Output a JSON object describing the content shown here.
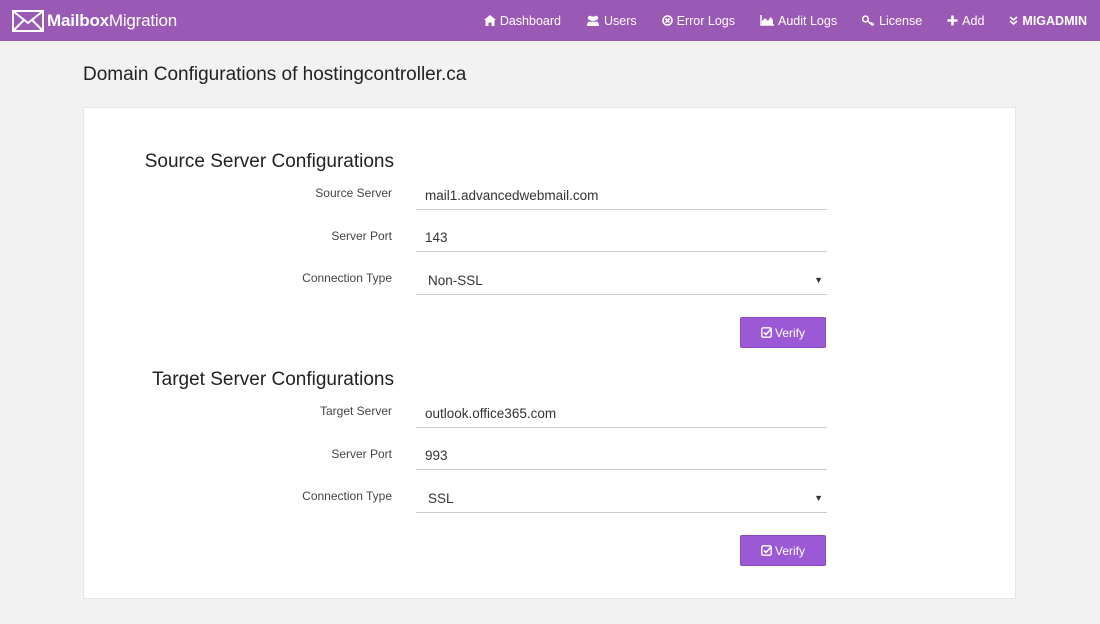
{
  "brand": {
    "part1": "Mailbox",
    "part2": "Migration"
  },
  "nav": [
    {
      "label": "Dashboard",
      "icon": "home-icon"
    },
    {
      "label": "Users",
      "icon": "users-icon"
    },
    {
      "label": "Error Logs",
      "icon": "error-circle-icon"
    },
    {
      "label": "Audit Logs",
      "icon": "area-chart-icon"
    },
    {
      "label": "License",
      "icon": "key-icon"
    },
    {
      "label": "Add",
      "icon": "plus-icon"
    },
    {
      "label": "MIGADMIN",
      "icon": "double-chevron-down-icon"
    }
  ],
  "page_title": "Domain Configurations of hostingcontroller.ca",
  "source": {
    "title": "Source Server Configurations",
    "server_label": "Source Server",
    "server_value": "mail1.advancedwebmail.com",
    "port_label": "Server Port",
    "port_value": "143",
    "conn_label": "Connection Type",
    "conn_value": "Non-SSL",
    "verify_label": "Verify"
  },
  "target": {
    "title": "Target Server Configurations",
    "server_label": "Target Server",
    "server_value": "outlook.office365.com",
    "port_label": "Server Port",
    "port_value": "993",
    "conn_label": "Connection Type",
    "conn_value": "SSL",
    "verify_label": "Verify"
  },
  "colors": {
    "nav_bg": "#9b59b6",
    "button_bg": "#9b59d6",
    "page_bg": "#f2f2f2"
  }
}
